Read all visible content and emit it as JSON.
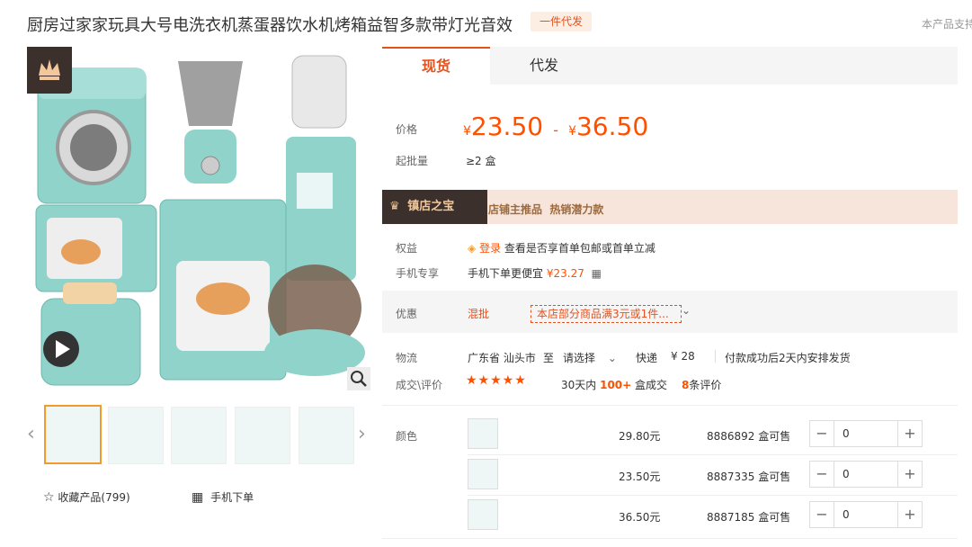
{
  "product": {
    "title": "厨房过家家玩具大号电洗衣机蒸蛋器饮水机烤箱益智多款带灯光音效",
    "dropship_badge": "一件代发",
    "support_text": "本产品支持"
  },
  "gallery": {
    "favorite_label": "收藏产品(799)",
    "mobile_order_label": "手机下单"
  },
  "tabs": [
    {
      "label": "现货",
      "active": true
    },
    {
      "label": "代发",
      "active": false
    }
  ],
  "pricing": {
    "price_label": "价格",
    "currency": "¥",
    "price_low": "23.50",
    "price_sep": "-",
    "price_high": "36.50",
    "moq_label": "起批量",
    "moq_value": "≥2 盒"
  },
  "banner": {
    "brand": "镇店之宝",
    "text": "店铺主推品  热销潜力款"
  },
  "rights": {
    "label": "权益",
    "login_link": "登录",
    "text": "查看是否享首单包邮或首单立减"
  },
  "mobile_deal": {
    "label": "手机专享",
    "text": "手机下单更便宜",
    "price": "¥23.27"
  },
  "discount": {
    "label": "优惠",
    "type": "混批",
    "coupon": "本店部分商品满3元或1件..."
  },
  "logistics": {
    "label": "物流",
    "from": "广东省 汕头市",
    "to_word": "至",
    "select": "请选择",
    "express": "快递",
    "fee": "¥ 28",
    "ship_note": "付款成功后2天内安排发货"
  },
  "deals": {
    "label": "成交\\评价",
    "stars": "★★★★★",
    "days": "30天内",
    "count": "100+",
    "unit": "盒成交",
    "review_count": "8",
    "review_unit": "条评价"
  },
  "variants": {
    "label": "颜色",
    "rows": [
      {
        "price": "29.80元",
        "stock": "8886892 盒可售",
        "qty": "0"
      },
      {
        "price": "23.50元",
        "stock": "8887335 盒可售",
        "qty": "0"
      },
      {
        "price": "36.50元",
        "stock": "8887185 盒可售",
        "qty": "0"
      }
    ]
  },
  "colors": {
    "accent": "#e5511d",
    "price": "#ff5000",
    "product_teal": "#8fd3cb",
    "selected_thumb": "#f29a2b"
  }
}
